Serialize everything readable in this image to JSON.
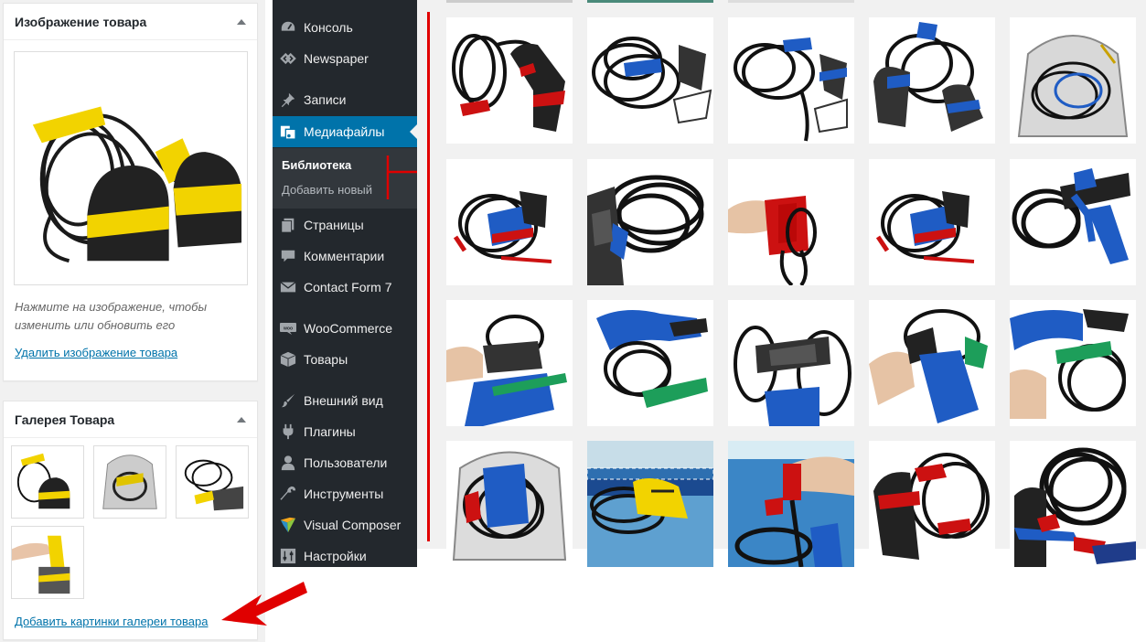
{
  "product_image_box": {
    "title": "Изображение товара",
    "hint": "Нажмите на изображение, чтобы изменить или обновить его",
    "remove_link": "Удалить изображение товара"
  },
  "gallery_box": {
    "title": "Галерея Товара",
    "add_link": "Добавить картинки галереи товара"
  },
  "admin_menu": {
    "items": [
      {
        "label": "Консоль",
        "icon": "dashboard-icon"
      },
      {
        "label": "Newspaper",
        "icon": "newspaper-icon"
      },
      {
        "label": "Записи",
        "icon": "pin-icon"
      },
      {
        "label": "Медиафайлы",
        "icon": "media-icon",
        "active": true
      },
      {
        "label": "Страницы",
        "icon": "pages-icon"
      },
      {
        "label": "Комментарии",
        "icon": "comment-icon"
      },
      {
        "label": "Contact Form 7",
        "icon": "mail-icon"
      },
      {
        "label": "WooCommerce",
        "icon": "woo-icon"
      },
      {
        "label": "Товары",
        "icon": "box-icon"
      },
      {
        "label": "Внешний вид",
        "icon": "brush-icon"
      },
      {
        "label": "Плагины",
        "icon": "plugin-icon"
      },
      {
        "label": "Пользователи",
        "icon": "user-icon"
      },
      {
        "label": "Инструменты",
        "icon": "wrench-icon"
      },
      {
        "label": "Visual Composer",
        "icon": "vc-icon"
      },
      {
        "label": "Настройки",
        "icon": "settings-icon"
      }
    ],
    "submenu": {
      "current": "Библиотека",
      "other": "Добавить новый"
    }
  },
  "colors": {
    "admin_bg": "#23282d",
    "submenu_bg": "#32373c",
    "active": "#0073aa",
    "annotation_red": "#e00000",
    "link": "#0073aa"
  }
}
